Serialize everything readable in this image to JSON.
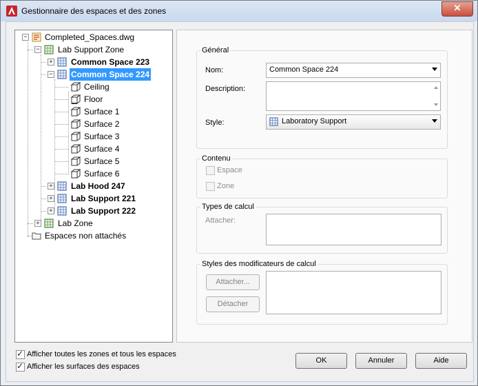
{
  "window": {
    "title": "Gestionnaire des espaces et des zones",
    "close_glyph": "✕"
  },
  "tree": {
    "root": "Completed_Spaces.dwg",
    "lab_support_zone": "Lab Support Zone",
    "common_space_223": "Common Space 223",
    "common_space_224": "Common Space 224",
    "ceiling": "Ceiling",
    "floor": "Floor",
    "surface_1": "Surface 1",
    "surface_2": "Surface 2",
    "surface_3": "Surface 3",
    "surface_4": "Surface 4",
    "surface_5": "Surface 5",
    "surface_6": "Surface 6",
    "lab_hood_247": "Lab Hood 247",
    "lab_support_221": "Lab Support 221",
    "lab_support_222": "Lab Support 222",
    "lab_zone": "Lab Zone",
    "unattached": "Espaces non attachés",
    "expanded_glyph": "−",
    "collapsed_glyph": "+"
  },
  "general": {
    "group_label": "Général",
    "name_label": "Nom:",
    "name_value": "Common Space 224",
    "description_label": "Description:",
    "description_value": "",
    "style_label": "Style:",
    "style_value": "Laboratory Support"
  },
  "content": {
    "group_label": "Contenu",
    "space_label": "Espace",
    "zone_label": "Zone"
  },
  "calc_types": {
    "group_label": "Types de calcul",
    "attach_label": "Attacher:"
  },
  "calc_modifiers": {
    "group_label": "Styles des modificateurs de calcul",
    "attach_button": "Attacher...",
    "detach_button": "Détacher"
  },
  "options": {
    "show_all_zones": "Afficher toutes les zones et tous les espaces",
    "show_all_zones_checked": true,
    "show_surfaces": "Afficher les surfaces des espaces",
    "show_surfaces_checked": true
  },
  "buttons": {
    "ok": "OK",
    "cancel": "Annuler",
    "help": "Aide"
  },
  "colors": {
    "selection": "#3399ff",
    "accent": "#c7503c"
  }
}
